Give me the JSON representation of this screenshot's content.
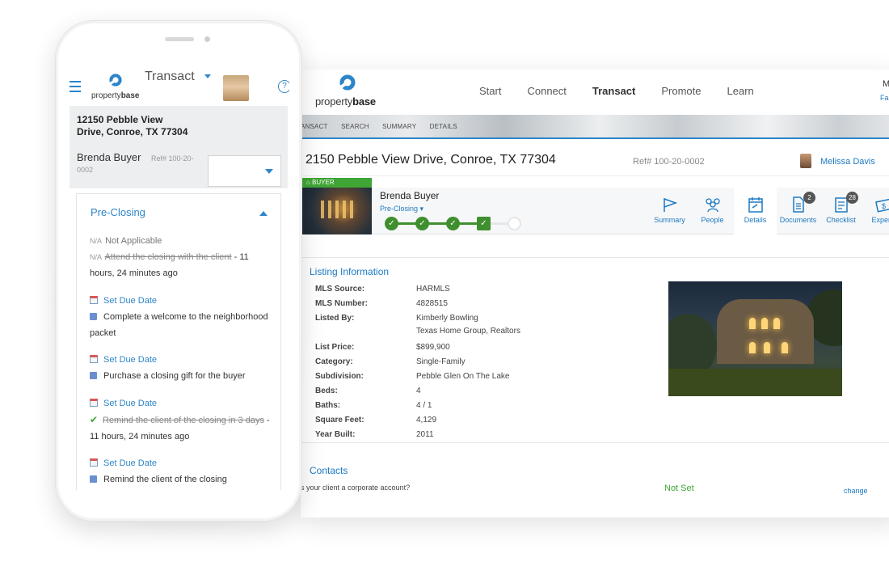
{
  "desktop": {
    "logo_text_light": "property",
    "logo_text_bold": "base",
    "nav": [
      "Start",
      "Connect",
      "Transact",
      "Promote",
      "Learn"
    ],
    "nav_active": "Transact",
    "user_edge_top": "M",
    "user_edge_bottom": "Fa",
    "breadcrumbs": [
      "ANSACT",
      "SEARCH",
      "SUMMARY",
      "DETAILS"
    ],
    "address": "2150 Pebble View Drive, Conroe, TX 77304",
    "ref": "Ref# 100-20-0002",
    "agent": "Melissa Davis",
    "buyer_tag": "BUYER",
    "buyer_name": "Brenda Buyer",
    "stage": "Pre-Closing",
    "progress": {
      "completed_steps": 4,
      "total_steps": 5
    },
    "tabs": [
      {
        "label": "Summary",
        "icon": "flag-icon",
        "badge": ""
      },
      {
        "label": "People",
        "icon": "people-icon",
        "badge": ""
      },
      {
        "label": "Details",
        "icon": "calendar-icon",
        "badge": ""
      },
      {
        "label": "Documents",
        "icon": "document-icon",
        "badge": "2"
      },
      {
        "label": "Checklist",
        "icon": "checklist-icon",
        "badge": "28"
      },
      {
        "label": "Expens",
        "icon": "dollar-icon",
        "badge": ""
      }
    ],
    "listing_title": "Listing Information",
    "listing": [
      {
        "k": "MLS Source:",
        "v": "HARMLS"
      },
      {
        "k": "MLS Number:",
        "v": "4828515"
      },
      {
        "k": "Listed By:",
        "v": "Kimberly Bowling",
        "v2": "Texas Home Group, Realtors"
      },
      {
        "k": "List Price:",
        "v": "$899,900"
      },
      {
        "k": "Category:",
        "v": "Single-Family"
      },
      {
        "k": "Subdivision:",
        "v": "Pebble Glen On The Lake"
      },
      {
        "k": "Beds:",
        "v": "4"
      },
      {
        "k": "Baths:",
        "v": "4 / 1"
      },
      {
        "k": "Square Feet:",
        "v": "4,129"
      },
      {
        "k": "Year Built:",
        "v": "2011"
      }
    ],
    "contacts_title": "Contacts",
    "contact_question": "s your client a corporate account?",
    "contact_value": "Not Set",
    "change_link": "change"
  },
  "phone": {
    "logo_text_light": "property",
    "logo_text_bold": "base",
    "app": "Transact",
    "help": "?",
    "address": "12150 Pebble View Drive, Conroe, TX 77304",
    "buyer": "Brenda Buyer",
    "ref": "Ref# 100-20-0002",
    "panel_title": "Pre-Closing",
    "na_label": "Not Applicable",
    "na_mark": "N/A",
    "task1_text": "Attend the closing with the client",
    "task1_time": " - 11 hours, 24 minutes ago",
    "due_label": "Set Due Date",
    "task2": "Complete a welcome to the neighborhood packet",
    "task3": "Purchase a closing gift for the buyer",
    "task4_text": "Remind the client of the closing in 3 days",
    "task4_time": " - 11 hours, 24 minutes ago",
    "task5": "Remind the client of the closing"
  }
}
